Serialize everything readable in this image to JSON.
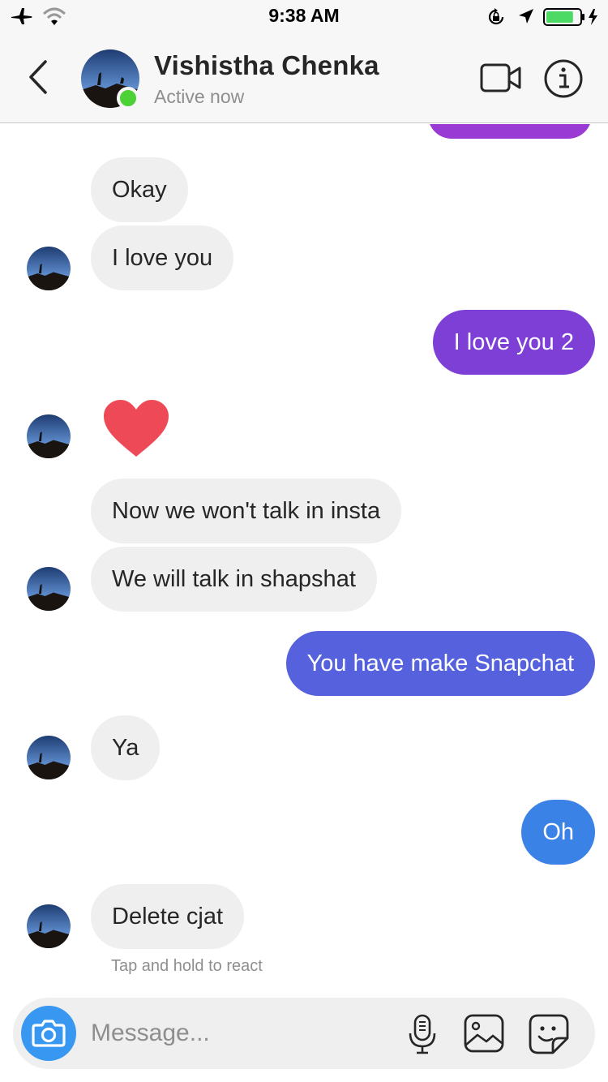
{
  "status_bar": {
    "time": "9:38 AM",
    "airplane_icon": "airplane-icon",
    "wifi_icon": "wifi-icon",
    "orientation_lock_icon": "orientation-lock-icon",
    "location_icon": "location-arrow-icon",
    "battery_icon": "battery-charging-icon",
    "battery_level": 0.82,
    "battery_color": "#4cd964"
  },
  "header": {
    "name": "Vishistha Chenka",
    "status": "Active now",
    "back_icon": "chevron-left-icon",
    "video_icon": "video-camera-icon",
    "info_icon": "info-icon",
    "online_color": "#4cd137"
  },
  "messages": [
    {
      "from": "them",
      "text": "Okay"
    },
    {
      "from": "them",
      "text": "I love you"
    },
    {
      "from": "me",
      "text": "I love you 2",
      "color": "#7d3fd6"
    },
    {
      "from": "them",
      "type": "emoji",
      "emoji": "heart-icon",
      "color": "#ed4956"
    },
    {
      "from": "them",
      "text": "Now we won't talk in insta"
    },
    {
      "from": "them",
      "text": "We will talk in shapshat"
    },
    {
      "from": "me",
      "text": "You have make Snapchat",
      "color": "#5561dd"
    },
    {
      "from": "them",
      "text": "Ya"
    },
    {
      "from": "me",
      "text": "Oh",
      "color": "#3b82e6"
    },
    {
      "from": "them",
      "text": "Delete cjat"
    }
  ],
  "react_hint": "Tap and hold to react",
  "composer": {
    "placeholder": "Message...",
    "camera_icon": "camera-icon",
    "mic_icon": "microphone-icon",
    "gallery_icon": "gallery-icon",
    "sticker_icon": "sticker-icon",
    "camera_color": "#3897f0"
  }
}
